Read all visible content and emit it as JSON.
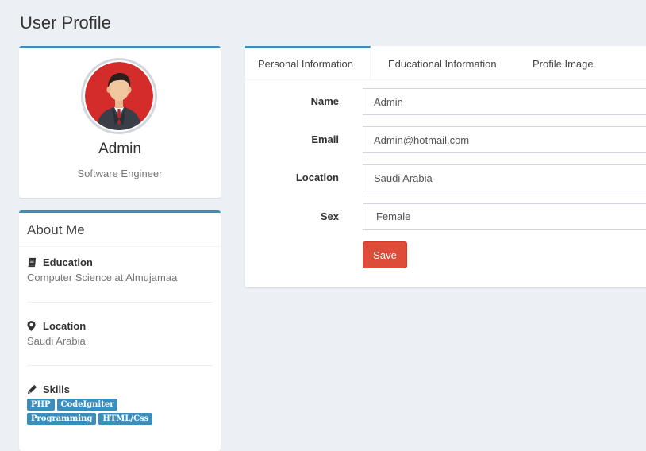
{
  "page": {
    "title": "User Profile"
  },
  "profile": {
    "name": "Admin",
    "role": "Software Engineer"
  },
  "about": {
    "title": "About Me",
    "education": {
      "heading": "Education",
      "text": "Computer Science at Almujamaa",
      "icon": "book-icon"
    },
    "location": {
      "heading": "Location",
      "text": "Saudi Arabia",
      "icon": "map-marker-icon"
    },
    "skills": {
      "heading": "Skills",
      "icon": "pencil-icon",
      "tags": [
        "PHP",
        "CodeIgniter",
        "Programming",
        "HTML/Css"
      ]
    }
  },
  "tabs": [
    {
      "label": "Personal Information",
      "active": true
    },
    {
      "label": "Educational Information",
      "active": false
    },
    {
      "label": "Profile Image",
      "active": false
    }
  ],
  "form": {
    "name": {
      "label": "Name",
      "value": "Admin"
    },
    "email": {
      "label": "Email",
      "value": "Admin@hotmail.com"
    },
    "location": {
      "label": "Location",
      "value": "Saudi Arabia"
    },
    "sex": {
      "label": "Sex",
      "value": "Female"
    },
    "save_label": "Save"
  },
  "colors": {
    "accent": "#3c8dbc",
    "danger": "#dd4b39",
    "background": "#ecf0f5"
  }
}
